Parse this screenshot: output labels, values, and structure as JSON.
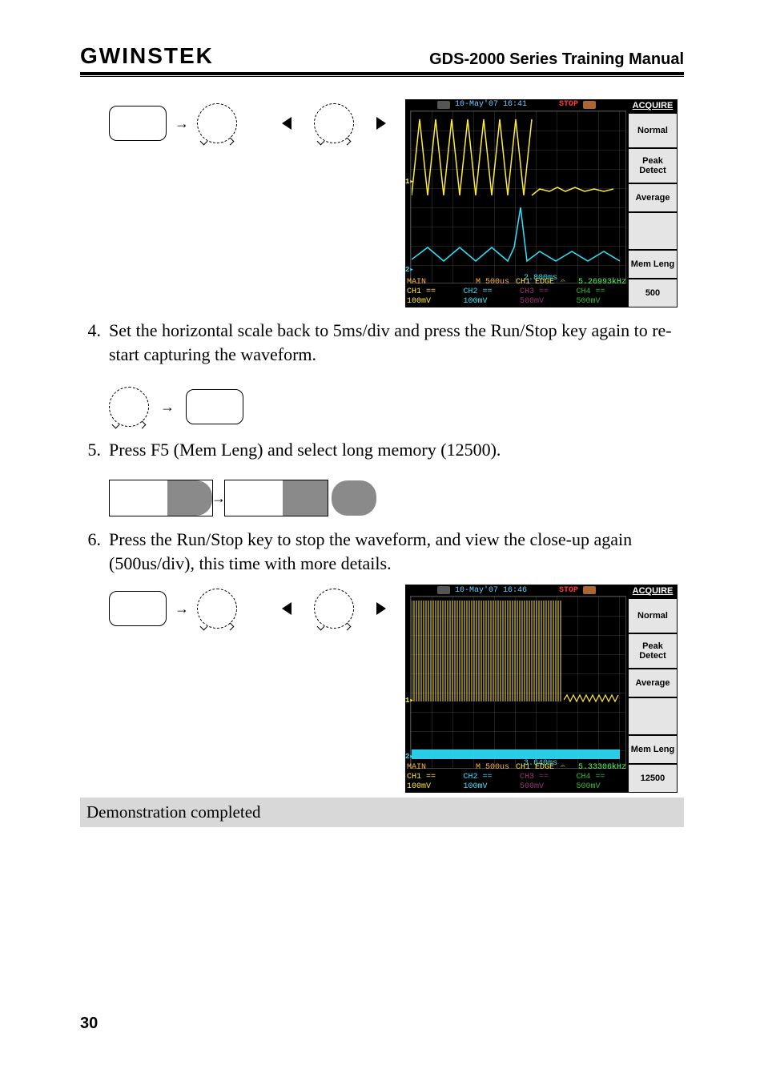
{
  "header": {
    "brand": "GWINSTEK",
    "title": "GDS-2000 Series Training Manual"
  },
  "steps": {
    "s4": {
      "num": "4.",
      "text": "Set the horizontal scale  back to 5ms/div and press the Run/Stop key again to re-start capturing the waveform."
    },
    "s5": {
      "num": "5.",
      "text": "Press F5 (Mem Leng) and select long memory (12500)."
    },
    "s6": {
      "num": "6.",
      "text": "Press the Run/Stop key to stop the waveform, and view the close-up again (500us/div), this time with more details."
    }
  },
  "oscope1": {
    "datetime": "10-May'07 16:41",
    "status": "STOP",
    "menu_title": "ACQUIRE",
    "menu": {
      "m1": "Normal",
      "m2a": "Peak",
      "m2b": "Detect",
      "m3": "Average",
      "m4": "Mem Leng",
      "m5": "500"
    },
    "cursor_delay": "2.800ms",
    "main_label": "MAIN",
    "timebase": "M 500us",
    "trigger": "CH1  EDGE",
    "freq": "5.26993kHz",
    "ch1": "CH1 == 100mV",
    "ch2": "CH2 == 100mV",
    "ch3": "CH3 == 500mV",
    "ch4": "CH4 == 500mV"
  },
  "oscope2": {
    "datetime": "10-May'07 16:46",
    "status": "STOP",
    "menu_title": "ACQUIRE",
    "menu": {
      "m1": "Normal",
      "m2a": "Peak",
      "m2b": "Detect",
      "m3": "Average",
      "m4": "Mem Leng",
      "m5": "12500"
    },
    "cursor_delay": "3.640ms",
    "main_label": "MAIN",
    "timebase": "M 500us",
    "trigger": "CH1  EDGE",
    "freq": "5.33306kHz",
    "ch1": "CH1 == 100mV",
    "ch2": "CH2 == 100mV",
    "ch3": "CH3 == 500mV",
    "ch4": "CH4 == 500mV"
  },
  "demo_complete": "Demonstration completed",
  "page_number": "30"
}
